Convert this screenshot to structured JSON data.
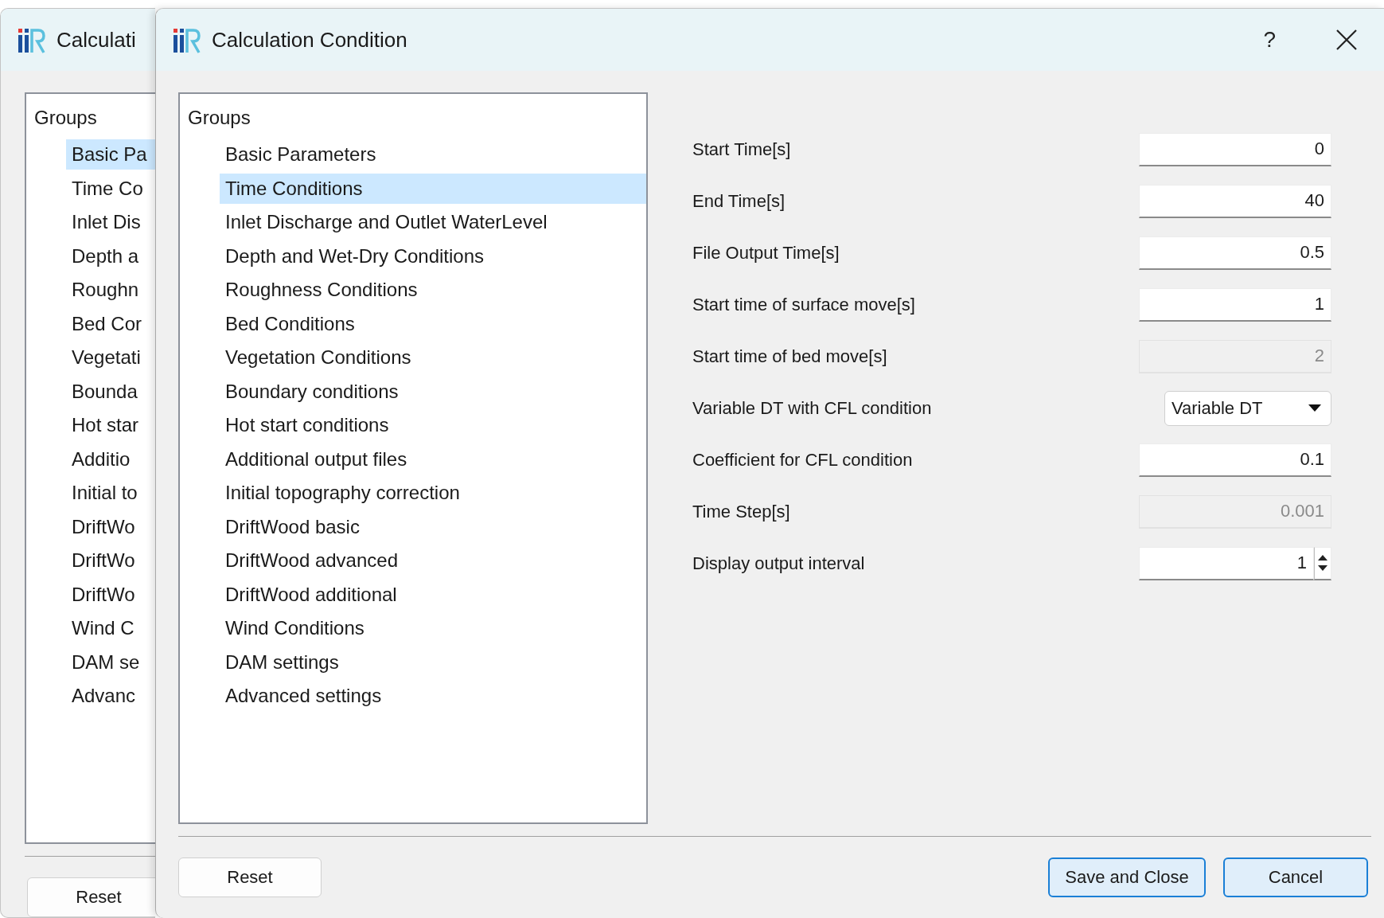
{
  "back_window": {
    "title": "Calculati",
    "groups_tree": {
      "label": "Groups",
      "children": [
        {
          "label": "Basic Pa",
          "selected": true
        },
        {
          "label": "Time Co",
          "selected": false
        },
        {
          "label": "Inlet Dis",
          "selected": false
        },
        {
          "label": "Depth a",
          "selected": false
        },
        {
          "label": "Roughn",
          "selected": false
        },
        {
          "label": "Bed Cor",
          "selected": false
        },
        {
          "label": "Vegetati",
          "selected": false
        },
        {
          "label": "Bounda",
          "selected": false
        },
        {
          "label": "Hot star",
          "selected": false
        },
        {
          "label": "Additio",
          "selected": false
        },
        {
          "label": "Initial to",
          "selected": false
        },
        {
          "label": "DriftWo",
          "selected": false
        },
        {
          "label": "DriftWo",
          "selected": false
        },
        {
          "label": "DriftWo",
          "selected": false
        },
        {
          "label": "Wind C",
          "selected": false
        },
        {
          "label": "DAM se",
          "selected": false
        },
        {
          "label": "Advanc",
          "selected": false
        }
      ]
    },
    "reset_button": "Reset"
  },
  "window": {
    "title": "Calculation Condition",
    "help_button": "?",
    "groups_tree": {
      "label": "Groups",
      "children": [
        {
          "label": "Basic Parameters",
          "selected": false
        },
        {
          "label": "Time Conditions",
          "selected": true
        },
        {
          "label": "Inlet Discharge and Outlet WaterLevel",
          "selected": false
        },
        {
          "label": "Depth and Wet-Dry Conditions",
          "selected": false
        },
        {
          "label": "Roughness Conditions",
          "selected": false
        },
        {
          "label": "Bed Conditions",
          "selected": false
        },
        {
          "label": "Vegetation Conditions",
          "selected": false
        },
        {
          "label": "Boundary conditions",
          "selected": false
        },
        {
          "label": "Hot start conditions",
          "selected": false
        },
        {
          "label": "Additional output files",
          "selected": false
        },
        {
          "label": "Initial topography correction",
          "selected": false
        },
        {
          "label": "DriftWood basic",
          "selected": false
        },
        {
          "label": "DriftWood advanced",
          "selected": false
        },
        {
          "label": "DriftWood additional",
          "selected": false
        },
        {
          "label": "Wind Conditions",
          "selected": false
        },
        {
          "label": "DAM settings",
          "selected": false
        },
        {
          "label": "Advanced settings",
          "selected": false
        }
      ]
    },
    "fields": [
      {
        "label": "Start Time[s]",
        "kind": "text",
        "value": "0",
        "disabled": false
      },
      {
        "label": "End Time[s]",
        "kind": "text",
        "value": "40",
        "disabled": false
      },
      {
        "label": "File Output Time[s]",
        "kind": "text",
        "value": "0.5",
        "disabled": false
      },
      {
        "label": "Start time of surface move[s]",
        "kind": "text",
        "value": "1",
        "disabled": false
      },
      {
        "label": "Start time of bed move[s]",
        "kind": "text",
        "value": "2",
        "disabled": true
      },
      {
        "label": "Variable DT with CFL condition",
        "kind": "select",
        "value": "Variable DT",
        "disabled": false
      },
      {
        "label": "Coefficient for CFL condition",
        "kind": "text",
        "value": "0.1",
        "disabled": false
      },
      {
        "label": "Time Step[s]",
        "kind": "text",
        "value": "0.001",
        "disabled": true
      },
      {
        "label": "Display output interval",
        "kind": "spin",
        "value": "1",
        "disabled": false
      }
    ],
    "buttons": {
      "reset": "Reset",
      "save": "Save and Close",
      "cancel": "Cancel"
    }
  }
}
